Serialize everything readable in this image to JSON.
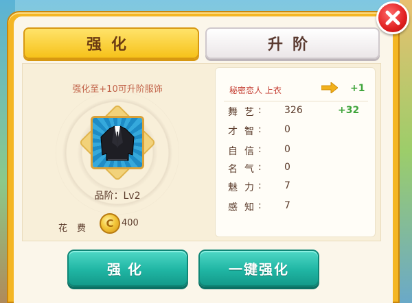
{
  "tabs": {
    "strengthen": "强化",
    "advance": "升阶"
  },
  "left": {
    "hint": "强化至+10可升阶服饰",
    "item_icon": "black-jacket-icon",
    "grade_label": "品阶：Lv2",
    "cost_label": "花费",
    "cost_colon": ":",
    "coin_icon": "gold-coin-icon",
    "coin_glyph": "C",
    "cost_value": "400"
  },
  "right": {
    "item_name": "秘密恋人 上衣",
    "arrow_icon": "arrow-right-icon",
    "level_up": "+1",
    "stats": [
      {
        "label": "舞艺",
        "value": "326",
        "bonus": "+32"
      },
      {
        "label": "才智",
        "value": "0",
        "bonus": ""
      },
      {
        "label": "自信",
        "value": "0",
        "bonus": ""
      },
      {
        "label": "名气",
        "value": "0",
        "bonus": ""
      },
      {
        "label": "魅力",
        "value": "7",
        "bonus": ""
      },
      {
        "label": "感知",
        "value": "7",
        "bonus": ""
      }
    ]
  },
  "buttons": {
    "strengthen": "强化",
    "one_click": "一键强化"
  },
  "close_icon": "close-icon",
  "colors": {
    "frame": "#f4b624",
    "active_tab": "#f6c21a",
    "button": "#20b6a4",
    "close": "#e02020",
    "bonus": "#3ea43a",
    "item_name": "#c2352a"
  }
}
